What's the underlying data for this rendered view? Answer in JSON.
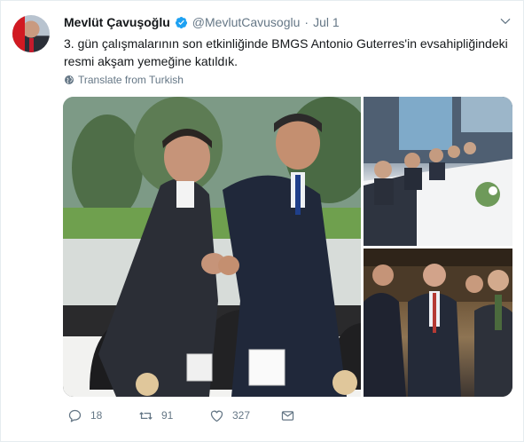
{
  "author": {
    "name": "Mevlüt Çavuşoğlu",
    "handle": "@MevlutCavusoglu",
    "separator": "·",
    "date": "Jul 1"
  },
  "tweet": {
    "text": "3. gün çalışmalarının son etkinliğinde BMGS Antonio Guterres'in evsahipliğindeki resmi akşam yemeğine katıldık.",
    "translate_label": "Translate from Turkish"
  },
  "stats": {
    "replies": "18",
    "retweets": "91",
    "likes": "327"
  },
  "colors": {
    "verified_blue": "#1da1f2",
    "muted": "#657786",
    "text": "#14171a"
  },
  "icons": [
    "verified-badge-icon",
    "chevron-down-icon",
    "globe-icon",
    "reply-icon",
    "retweet-icon",
    "like-icon",
    "direct-message-icon"
  ]
}
